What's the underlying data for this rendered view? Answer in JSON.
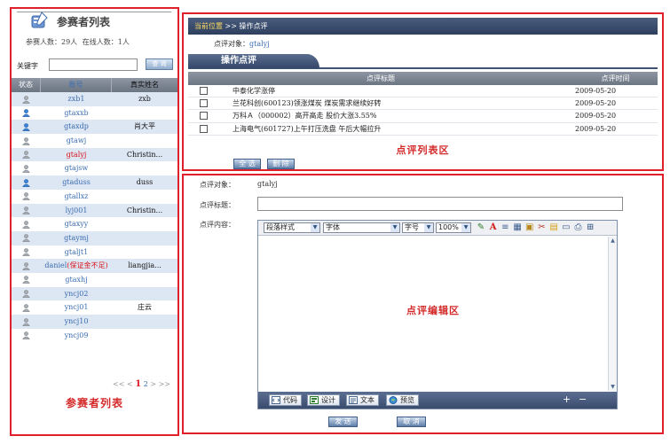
{
  "participants": {
    "title": "参赛者列表",
    "stats": {
      "total": "参赛人数：29人",
      "online": "在线人数：1人"
    },
    "search": {
      "label": "关键字",
      "value": "",
      "button": "查 询"
    },
    "columns": [
      "状态",
      "账号",
      "真实姓名"
    ],
    "rows": [
      {
        "status": "offline",
        "account": "zxb1",
        "name": "zxb",
        "highlight": false
      },
      {
        "status": "online",
        "account": "gtaxxb",
        "name": "",
        "highlight": false
      },
      {
        "status": "online",
        "account": "gtaxdp",
        "name": "肖大平",
        "highlight": false
      },
      {
        "status": "offline",
        "account": "gtawj",
        "name": "",
        "highlight": false
      },
      {
        "status": "offline",
        "account": "gtalyj",
        "name": "Christin...",
        "highlight": true
      },
      {
        "status": "offline",
        "account": "gtajsw",
        "name": "",
        "highlight": false
      },
      {
        "status": "online",
        "account": "gtaduss",
        "name": "duss",
        "highlight": false
      },
      {
        "status": "offline",
        "account": "gtallxz",
        "name": "",
        "highlight": false
      },
      {
        "status": "offline",
        "account": "lyj001",
        "name": "Christin...",
        "highlight": false
      },
      {
        "status": "offline",
        "account": "gtaxyy",
        "name": "",
        "highlight": false
      },
      {
        "status": "offline",
        "account": "gtaymj",
        "name": "",
        "highlight": false
      },
      {
        "status": "offline",
        "account": "gtaljt1",
        "name": "",
        "highlight": false
      },
      {
        "status": "offline",
        "account": "daniel",
        "account_note": "(保证金不足)",
        "name": "liangjia...",
        "highlight": false
      },
      {
        "status": "offline",
        "account": "gtaxhj",
        "name": "",
        "highlight": false
      },
      {
        "status": "offline",
        "account": "yncj02",
        "name": "",
        "highlight": false
      },
      {
        "status": "offline",
        "account": "yncj01",
        "name": "庄云",
        "highlight": false
      },
      {
        "status": "offline",
        "account": "yncj10",
        "name": "",
        "highlight": false
      },
      {
        "status": "offline",
        "account": "yncj09",
        "name": "",
        "highlight": false
      }
    ],
    "pager": {
      "prev": "<< <",
      "current": "1",
      "next_page": "2",
      "next": "> >>"
    },
    "caption": "参赛者列表"
  },
  "comment_list": {
    "breadcrumb": {
      "location_label": "当前位置",
      "separator": ">>",
      "current": "操作点评"
    },
    "target": {
      "label": "点评对象：",
      "value": "gtalyj"
    },
    "tab": "操作点评",
    "columns": {
      "title": "点评标题",
      "time": "点评时间"
    },
    "rows": [
      {
        "title": "中泰化学涨停",
        "time": "2009-05-20"
      },
      {
        "title": "兰花科创(600123)领涨煤炭  煤炭需求继续好转",
        "time": "2009-05-20"
      },
      {
        "title": "万科Ａ（000002）高开高走  股价大涨3.55%",
        "time": "2009-05-20"
      },
      {
        "title": "上海电气(601727)上午打压洗盘  午后大幅拉升",
        "time": "2009-05-20"
      }
    ],
    "caption": "点评列表区",
    "buttons": {
      "select_all": "全 选",
      "delete": "删 除"
    }
  },
  "editor_panel": {
    "target_label": "点评对象：",
    "target_value": "gtalyj",
    "title_label": "点评标题：",
    "title_value": "",
    "content_label": "点评内容：",
    "toolbar": {
      "paragraph": "段落样式",
      "font": "字体",
      "size": "字号",
      "zoom": "100%"
    },
    "caption": "点评编辑区",
    "modes": {
      "code": "代码",
      "design": "设计",
      "text": "文本",
      "preview": "预览"
    },
    "zoom_in": "+",
    "zoom_out": "−",
    "buttons": {
      "send": "发 送",
      "cancel": "取 消"
    }
  },
  "colors": {
    "highlight_red": "#e0202a",
    "link_blue": "#3a6cb0",
    "header_navy": "#2e3f5e",
    "row_stripe": "#dde6f3"
  }
}
